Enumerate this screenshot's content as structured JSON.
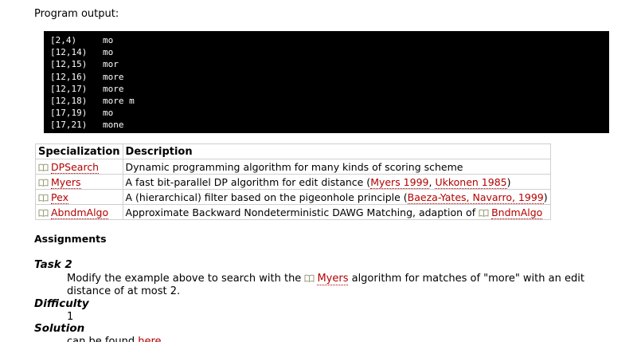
{
  "output_label": "Program output:",
  "console_lines": [
    {
      "range": "[2,4)",
      "text": "mo"
    },
    {
      "range": "[12,14)",
      "text": "mo"
    },
    {
      "range": "[12,15)",
      "text": "mor"
    },
    {
      "range": "[12,16)",
      "text": "more"
    },
    {
      "range": "[12,17)",
      "text": "more"
    },
    {
      "range": "[12,18)",
      "text": "more m"
    },
    {
      "range": "[17,19)",
      "text": "mo"
    },
    {
      "range": "[17,21)",
      "text": "mone"
    }
  ],
  "table": {
    "headers": [
      "Specialization",
      "Description"
    ],
    "rows": [
      {
        "name": "DPSearch",
        "desc": "Dynamic programming algorithm for many kinds of scoring scheme"
      },
      {
        "name": "Myers",
        "desc_pre": "A fast bit-parallel DP algorithm for edit distance (",
        "link1": "Myers 1999",
        "sep": ", ",
        "link2": "Ukkonen 1985",
        "desc_post": ")"
      },
      {
        "name": "Pex",
        "desc_pre": "A (hierarchical) filter based on the pigeonhole principle (",
        "link1": "Baeza-Yates, Navarro, 1999",
        "desc_post": ")"
      },
      {
        "name": "AbndmAlgo",
        "desc_pre": "Approximate Backward Nondeterministic DAWG Matching, adaption of ",
        "link1": "BndmAlgo"
      }
    ]
  },
  "assignments_heading": "Assignments",
  "task": {
    "heading": "Task 2",
    "text_pre": "Modify the example above to search with the ",
    "link": "Myers",
    "text_post": " algorithm for matches of \"more\" with an edit distance of at most 2."
  },
  "difficulty": {
    "heading": "Difficulty",
    "value": "1"
  },
  "solution": {
    "heading": "Solution",
    "text_pre": "can be found ",
    "link": "here"
  },
  "colors": {
    "link": "#b30000",
    "console_bg": "#000000"
  },
  "icons": {
    "spec_link": "book-icon"
  }
}
